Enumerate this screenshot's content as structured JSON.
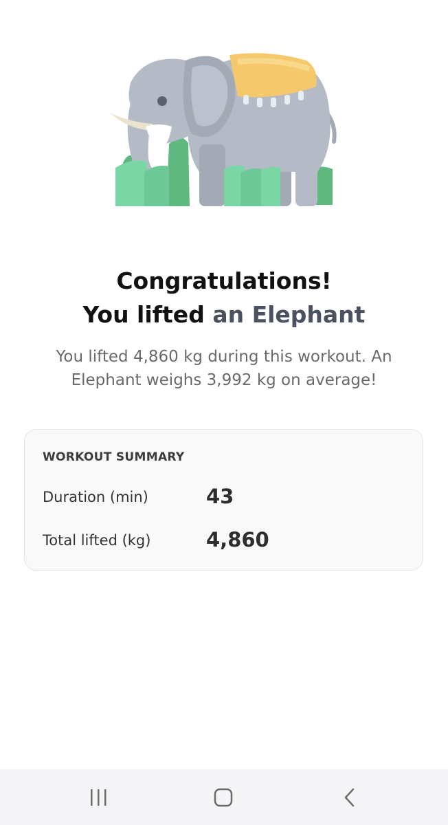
{
  "illustration": {
    "icon": "elephant-icon",
    "colors": {
      "body": "#b4bac6",
      "ear": "#a3a9b5",
      "blanket": "#f5c96b",
      "grass_light": "#7bd6a6",
      "grass_dark": "#5fb880",
      "tusk": "#ece3cf"
    }
  },
  "headline": {
    "line1": "Congratulations!",
    "line2_prefix": "You lifted",
    "line2_accent": "an Elephant"
  },
  "description": "You lifted 4,860 kg during this workout. An Elephant weighs 3,992 kg on average!",
  "summary": {
    "title": "WORKOUT SUMMARY",
    "rows": [
      {
        "label": "Duration (min)",
        "value": "43"
      },
      {
        "label": "Total lifted (kg)",
        "value": "4,860"
      }
    ]
  },
  "navbar": {
    "buttons": [
      "recent-apps-icon",
      "home-icon",
      "back-icon"
    ],
    "background": "#f4f4f6"
  },
  "colors": {
    "accent_text": "#4a5160",
    "card_background": "#f9f9f9"
  }
}
